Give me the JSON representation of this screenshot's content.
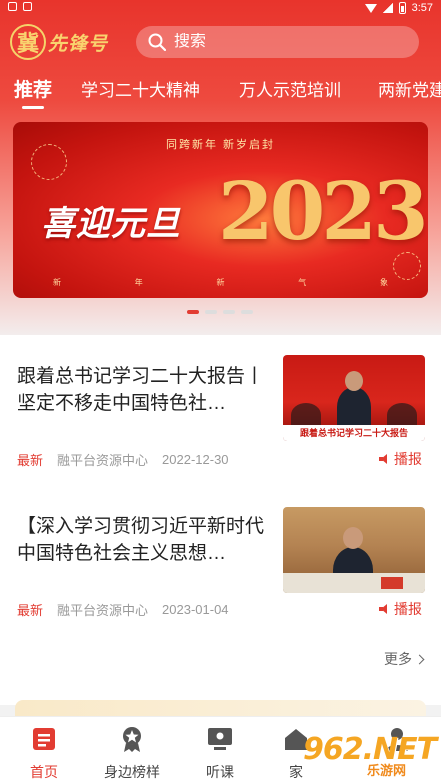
{
  "status_bar": {
    "time": "3:57"
  },
  "header": {
    "logo_mark": "冀",
    "logo_text": "先锋号",
    "search_placeholder": "搜索"
  },
  "tabs": [
    {
      "label": "推荐",
      "active": true
    },
    {
      "label": "学习二十大精神"
    },
    {
      "label": "万人示范培训"
    },
    {
      "label": "两新党建"
    }
  ],
  "banner": {
    "top_text": "同跨新年    新岁启封",
    "greeting": "喜迎元旦",
    "year": "2023",
    "bottom_chars": [
      "新",
      "年",
      "新",
      "气",
      "象"
    ],
    "page_count": 4,
    "active_page": 1
  },
  "news": [
    {
      "title": "跟着总书记学习二十大报告丨坚定不移走中国特色社…",
      "tag": "最新",
      "source": "融平台资源中心",
      "date": "2022-12-30",
      "action": "播报",
      "image_caption": "跟着总书记学习二十大报告"
    },
    {
      "title": "【深入学习贯彻习近平新时代中国特色社会主义思想…",
      "tag": "最新",
      "source": "融平台资源中心",
      "date": "2023-01-04",
      "action": "播报"
    }
  ],
  "more_label": "更多",
  "tabbar": [
    {
      "label": "首页",
      "icon": "home-icon",
      "active": true
    },
    {
      "label": "身边榜样",
      "icon": "badge-icon"
    },
    {
      "label": "听课",
      "icon": "lecture-icon"
    },
    {
      "label": "家",
      "icon": "home2-icon"
    },
    {
      "label": "",
      "icon": "profile-icon"
    }
  ],
  "watermark": {
    "brand": "962.NET",
    "sub": "乐游网"
  },
  "colors": {
    "primary": "#e23c32",
    "gold": "#f9d36e"
  }
}
